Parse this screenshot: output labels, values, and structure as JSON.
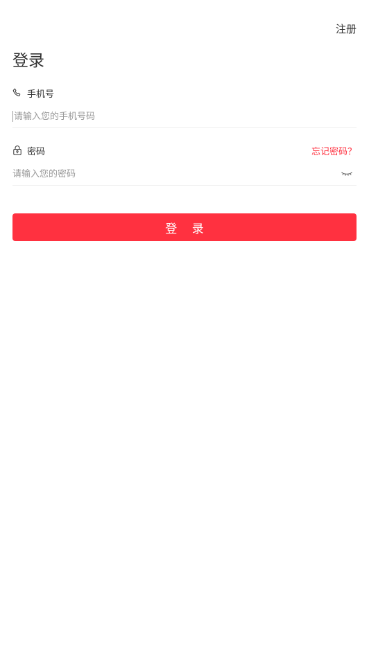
{
  "header": {
    "register_label": "注册",
    "title": "登录"
  },
  "phone": {
    "label": "手机号",
    "icon": "phone-icon",
    "placeholder": "请输入您的手机号码",
    "value": ""
  },
  "password": {
    "label": "密码",
    "icon": "lock-icon",
    "forgot_label": "忘记密码？",
    "placeholder": "请输入您的密码",
    "value": "",
    "toggle_icon": "eye-closed-icon"
  },
  "actions": {
    "login_label": "登 录"
  },
  "colors": {
    "accent": "#ff3140",
    "text": "#333333",
    "placeholder": "#999999",
    "divider": "#efefef"
  }
}
